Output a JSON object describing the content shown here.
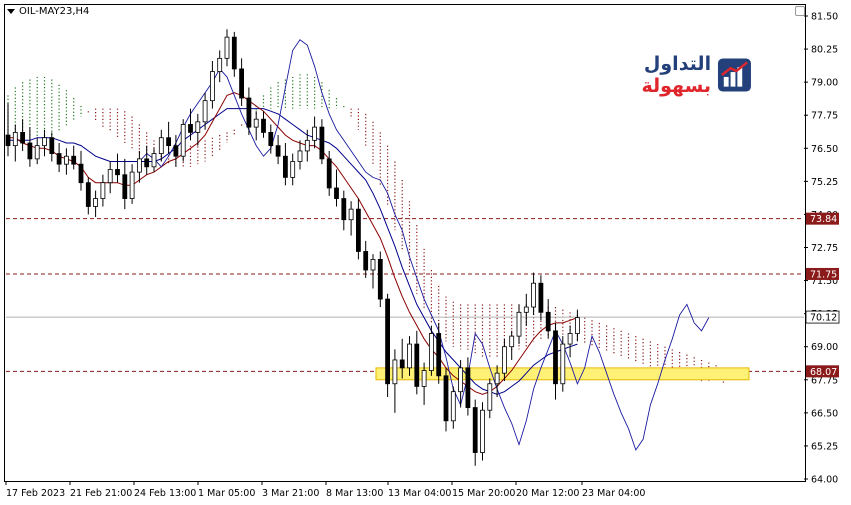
{
  "window": {
    "title": "OIL-MAY23,H4"
  },
  "logo": {
    "text_red": "بسهولة",
    "text_blue": "التداول",
    "icon": "bar-chart-logo-icon"
  },
  "colors": {
    "tenkan": "#8b0000",
    "kijun": "#00008b",
    "cloud_bullish": "#1f7a1f",
    "cloud_bearish": "#8b1a1a",
    "level_line": "#8b1a1a",
    "level_label_bg": "#8b1a1a",
    "support_zone_fill": "#fff176",
    "support_zone_border": "#e6b800",
    "current_price_line": "#b0b0b0",
    "candle_bull": "#ffffff",
    "candle_bear": "#000000"
  },
  "chart_data": {
    "type": "candlestick",
    "symbol": "OIL-MAY23",
    "timeframe": "H4",
    "ylim": [
      64.0,
      81.5
    ],
    "y_ticks": [
      "81.50",
      "80.25",
      "79.00",
      "77.75",
      "76.50",
      "75.25",
      "74.00",
      "72.75",
      "71.50",
      "70.25",
      "69.00",
      "67.75",
      "66.50",
      "65.25",
      "64.00"
    ],
    "x_ticks": [
      "17 Feb 2023",
      "21 Feb 21:00",
      "24 Feb 13:00",
      "1 Mar 05:00",
      "3 Mar 21:00",
      "8 Mar 13:00",
      "13 Mar 04:00",
      "15 Mar 20:00",
      "20 Mar 12:00",
      "23 Mar 04:00"
    ],
    "levels": [
      {
        "label": "73.84",
        "value": 73.84
      },
      {
        "label": "71.75",
        "value": 71.75
      },
      {
        "label": "68.07",
        "value": 68.07
      }
    ],
    "current_price": {
      "label": "70.12",
      "value": 70.12
    },
    "support_zone": {
      "from": 67.75,
      "to": 68.2
    },
    "candles": [
      [
        77.0,
        78.2,
        76.2,
        76.6
      ],
      [
        76.6,
        77.4,
        76.0,
        77.1
      ],
      [
        77.1,
        77.6,
        76.4,
        76.7
      ],
      [
        76.7,
        77.3,
        75.8,
        76.1
      ],
      [
        76.1,
        76.9,
        75.9,
        76.6
      ],
      [
        76.6,
        77.2,
        76.2,
        76.9
      ],
      [
        76.9,
        77.1,
        76.0,
        76.3
      ],
      [
        76.3,
        76.7,
        75.6,
        75.9
      ],
      [
        75.9,
        76.5,
        75.5,
        76.2
      ],
      [
        76.2,
        76.6,
        75.7,
        75.9
      ],
      [
        75.9,
        76.4,
        74.9,
        75.2
      ],
      [
        75.2,
        75.4,
        74.0,
        74.3
      ],
      [
        74.3,
        74.9,
        73.9,
        74.6
      ],
      [
        74.6,
        75.5,
        74.3,
        75.2
      ],
      [
        75.2,
        76.0,
        74.8,
        75.7
      ],
      [
        75.7,
        76.3,
        75.2,
        75.5
      ],
      [
        75.5,
        76.1,
        74.2,
        74.6
      ],
      [
        74.6,
        75.9,
        74.4,
        75.6
      ],
      [
        75.6,
        76.4,
        75.2,
        76.1
      ],
      [
        76.1,
        76.6,
        75.5,
        75.8
      ],
      [
        75.8,
        76.5,
        75.6,
        76.3
      ],
      [
        76.3,
        77.2,
        76.0,
        76.9
      ],
      [
        76.9,
        77.5,
        76.3,
        76.6
      ],
      [
        76.6,
        77.0,
        75.8,
        76.2
      ],
      [
        76.2,
        77.6,
        76.0,
        77.4
      ],
      [
        77.4,
        78.0,
        76.8,
        77.1
      ],
      [
        77.1,
        77.8,
        76.6,
        77.5
      ],
      [
        77.5,
        78.6,
        77.2,
        78.3
      ],
      [
        78.3,
        79.8,
        78.0,
        79.4
      ],
      [
        79.4,
        80.2,
        79.0,
        79.9
      ],
      [
        79.9,
        81.0,
        79.6,
        80.7
      ],
      [
        80.7,
        80.9,
        79.2,
        79.5
      ],
      [
        79.5,
        79.9,
        78.1,
        78.4
      ],
      [
        78.4,
        78.8,
        77.0,
        77.3
      ],
      [
        77.3,
        77.9,
        76.8,
        77.6
      ],
      [
        77.6,
        77.9,
        76.9,
        77.1
      ],
      [
        77.1,
        77.4,
        76.3,
        76.6
      ],
      [
        76.6,
        77.0,
        75.9,
        76.2
      ],
      [
        76.2,
        76.7,
        75.1,
        75.4
      ],
      [
        75.4,
        76.3,
        75.1,
        76.0
      ],
      [
        76.0,
        76.8,
        75.7,
        76.4
      ],
      [
        76.4,
        77.2,
        76.0,
        76.8
      ],
      [
        76.8,
        77.7,
        76.5,
        77.3
      ],
      [
        77.3,
        77.6,
        75.9,
        76.1
      ],
      [
        76.1,
        76.4,
        74.7,
        75.0
      ],
      [
        75.0,
        75.7,
        74.3,
        74.6
      ],
      [
        74.6,
        74.9,
        73.4,
        73.8
      ],
      [
        73.8,
        74.5,
        73.2,
        74.2
      ],
      [
        74.2,
        74.6,
        72.3,
        72.6
      ],
      [
        72.6,
        73.0,
        71.6,
        71.9
      ],
      [
        71.9,
        72.5,
        71.2,
        72.3
      ],
      [
        72.3,
        72.6,
        70.5,
        70.8
      ],
      [
        70.8,
        71.0,
        67.1,
        67.6
      ],
      [
        67.6,
        68.9,
        66.5,
        68.5
      ],
      [
        68.5,
        69.3,
        67.8,
        68.2
      ],
      [
        68.2,
        69.4,
        67.9,
        69.1
      ],
      [
        69.1,
        69.6,
        67.2,
        67.5
      ],
      [
        67.5,
        68.4,
        66.8,
        68.1
      ],
      [
        68.1,
        69.8,
        67.9,
        69.5
      ],
      [
        69.5,
        69.9,
        67.6,
        67.9
      ],
      [
        67.9,
        68.2,
        65.8,
        66.2
      ],
      [
        66.2,
        67.5,
        65.9,
        67.3
      ],
      [
        67.3,
        68.5,
        66.7,
        68.2
      ],
      [
        68.2,
        68.6,
        66.4,
        66.7
      ],
      [
        66.7,
        67.0,
        64.5,
        65.0
      ],
      [
        65.0,
        66.9,
        64.7,
        66.6
      ],
      [
        66.6,
        67.8,
        66.3,
        67.6
      ],
      [
        67.6,
        68.3,
        67.1,
        68.0
      ],
      [
        68.0,
        69.3,
        67.7,
        69.0
      ],
      [
        69.0,
        69.6,
        68.5,
        69.4
      ],
      [
        69.4,
        70.6,
        69.1,
        70.3
      ],
      [
        70.3,
        71.0,
        69.8,
        70.5
      ],
      [
        70.5,
        71.8,
        70.2,
        71.4
      ],
      [
        71.4,
        71.7,
        70.0,
        70.3
      ],
      [
        70.3,
        70.8,
        69.3,
        69.6
      ],
      [
        69.6,
        69.9,
        67.0,
        67.6
      ],
      [
        67.6,
        69.4,
        67.3,
        69.1
      ],
      [
        69.1,
        69.8,
        68.6,
        69.5
      ],
      [
        69.5,
        70.4,
        69.2,
        70.1
      ]
    ],
    "tenkan_sen": [
      76.9,
      76.9,
      76.7,
      76.6,
      76.5,
      76.5,
      76.4,
      76.2,
      76.1,
      76.0,
      75.8,
      75.4,
      75.2,
      75.2,
      75.2,
      75.2,
      75.1,
      75.1,
      75.3,
      75.5,
      75.6,
      75.8,
      76.0,
      76.1,
      76.3,
      76.5,
      76.7,
      77.0,
      77.5,
      78.0,
      78.5,
      78.6,
      78.5,
      78.3,
      78.1,
      77.9,
      77.6,
      77.3,
      77.0,
      76.8,
      76.7,
      76.6,
      76.6,
      76.4,
      76.1,
      75.8,
      75.4,
      75.0,
      74.6,
      74.1,
      73.6,
      73.1,
      72.4,
      71.6,
      70.9,
      70.3,
      69.8,
      69.3,
      68.9,
      68.6,
      68.2,
      67.9,
      67.7,
      67.5,
      67.3,
      67.2,
      67.3,
      67.5,
      67.8,
      68.1,
      68.5,
      68.9,
      69.3,
      69.6,
      69.8,
      69.9,
      69.9,
      70.0,
      70.1
    ],
    "kijun_sen": [
      76.8,
      76.8,
      76.8,
      76.8,
      76.9,
      76.9,
      76.9,
      76.8,
      76.7,
      76.7,
      76.6,
      76.4,
      76.2,
      76.1,
      76.0,
      76.0,
      76.0,
      76.0,
      76.0,
      76.0,
      76.0,
      76.1,
      76.3,
      76.5,
      76.8,
      77.0,
      77.2,
      77.4,
      77.6,
      77.8,
      78.0,
      78.0,
      78.0,
      78.0,
      78.0,
      78.0,
      77.9,
      77.8,
      77.6,
      77.4,
      77.2,
      77.0,
      76.9,
      76.8,
      76.7,
      76.5,
      76.2,
      75.9,
      75.6,
      75.3,
      74.8,
      74.2,
      73.5,
      72.8,
      72.0,
      71.3,
      70.6,
      70.1,
      69.6,
      69.2,
      68.8,
      68.5,
      68.2,
      67.9,
      67.6,
      67.4,
      67.3,
      67.2,
      67.3,
      67.5,
      67.7,
      68.0,
      68.3,
      68.5,
      68.7,
      68.8,
      68.9,
      69.0,
      69.1
    ],
    "cloud": {
      "span_a": [
        78.5,
        78.8,
        79.0,
        79.1,
        79.2,
        79.2,
        79.1,
        78.9,
        78.7,
        78.4,
        78.1,
        77.8,
        77.5,
        77.3,
        77.1,
        76.9,
        76.7,
        76.5,
        76.3,
        76.2,
        76.1,
        76.0,
        75.9,
        75.8,
        75.8,
        75.8,
        75.9,
        76.0,
        76.2,
        76.4,
        76.7,
        77.0,
        77.3,
        77.7,
        78.1,
        78.5,
        78.8,
        79.0,
        79.1,
        79.2,
        79.3,
        79.3,
        79.2,
        79.0,
        78.7,
        78.4,
        78.1,
        77.7,
        77.2,
        76.6,
        75.9,
        75.1,
        74.3,
        73.4,
        72.6,
        71.8,
        71.0,
        70.4,
        69.9,
        69.5,
        69.2,
        69.0,
        68.9,
        68.8,
        68.7,
        68.6,
        68.6,
        68.6,
        68.7,
        68.8,
        68.9,
        69.0,
        69.2,
        69.3,
        69.4,
        69.4,
        69.4,
        69.3,
        69.2,
        69.1,
        69.0,
        68.9,
        68.8,
        68.7,
        68.6,
        68.5,
        68.4,
        68.3,
        68.2,
        68.1,
        68.0,
        67.9,
        67.9,
        67.8,
        67.8,
        67.7,
        67.7,
        67.7,
        67.6
      ],
      "span_b": [
        76.8,
        76.8,
        76.8,
        76.8,
        76.9,
        76.9,
        77.0,
        77.1,
        77.3,
        77.5,
        77.7,
        77.9,
        78.0,
        78.0,
        78.0,
        78.0,
        77.9,
        77.7,
        77.4,
        77.1,
        76.8,
        76.6,
        76.5,
        76.5,
        76.5,
        76.6,
        76.7,
        76.8,
        76.9,
        77.0,
        77.1,
        77.2,
        77.4,
        77.6,
        77.8,
        78.0,
        78.0,
        78.0,
        78.0,
        78.0,
        78.0,
        78.0,
        78.0,
        78.0,
        78.0,
        78.0,
        78.0,
        78.0,
        78.0,
        77.8,
        77.5,
        77.1,
        76.6,
        76.0,
        75.3,
        74.5,
        73.6,
        72.7,
        71.9,
        71.3,
        70.9,
        70.7,
        70.6,
        70.6,
        70.6,
        70.6,
        70.6,
        70.6,
        70.6,
        70.6,
        70.6,
        70.6,
        70.5,
        70.5,
        70.5,
        70.5,
        70.4,
        70.3,
        70.2,
        70.1,
        70.0,
        69.9,
        69.8,
        69.7,
        69.6,
        69.5,
        69.4,
        69.3,
        69.2,
        69.1,
        69.0,
        68.9,
        68.8,
        68.7,
        68.6,
        68.5,
        68.4,
        68.3,
        68.2
      ]
    },
    "chikou_span": [
      76.0,
      76.3,
      76.1,
      75.8,
      76.2,
      76.7,
      77.3,
      77.8,
      78.2,
      78.6,
      79.0,
      79.5,
      79.2,
      78.5,
      77.8,
      77.2,
      76.6,
      76.2,
      76.5,
      77.4,
      78.8,
      80.2,
      80.6,
      80.4,
      79.6,
      78.6,
      77.8,
      77.2,
      76.8,
      76.4,
      76.0,
      75.6,
      75.4,
      75.3,
      74.8,
      74.0,
      73.4,
      72.4,
      71.6,
      70.8,
      70.2,
      69.6,
      68.6,
      67.4,
      66.8,
      67.9,
      69.5,
      69.1,
      68.2,
      67.4,
      66.7,
      66.1,
      65.3,
      66.2,
      67.4,
      68.2,
      68.9,
      69.6,
      69.1,
      68.4,
      67.6,
      68.2,
      69.4,
      68.8,
      68.0,
      67.2,
      66.5,
      65.9,
      65.1,
      65.5,
      66.8,
      67.6,
      68.5,
      69.3,
      70.2,
      70.6,
      69.9,
      69.6,
      70.1
    ]
  }
}
